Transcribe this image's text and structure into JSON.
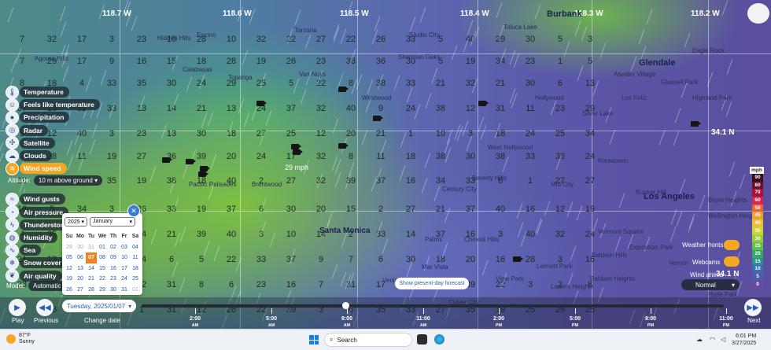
{
  "map": {
    "longitudes": [
      "118.7 W",
      "118.6 W",
      "118.5 W",
      "118.4 W",
      "118.3 W",
      "118.2 W"
    ],
    "latitude_labels": [
      "34.1 N",
      "34.1 N"
    ],
    "wind_readout": "29 mph",
    "cities": [
      "Glendale",
      "Burbank",
      "Los Angeles",
      "Santa Monica"
    ],
    "places": [
      "Calabasas",
      "Tarzana",
      "Sherman Oaks",
      "West Hollywood",
      "Beverly Hills",
      "Century City",
      "Topanga",
      "Hidden Hills",
      "Agoura Hills",
      "Mar Vista",
      "Venice",
      "Baldwin Hills",
      "Leimert Park",
      "Bunker Hill",
      "Wellington Heights",
      "Baldwin Heights",
      "Culver City",
      "Eagle Rock",
      "Glassell Park",
      "Silver Lake",
      "Hyde Park",
      "Ladera Heights",
      "View Park",
      "Cheviot Hills",
      "Palms",
      "Brentwood",
      "Pacific Palisades",
      "Westwood",
      "Encino",
      "Van Nuys",
      "Studio City",
      "Toluca Lake",
      "Mid City",
      "Koreatown",
      "Vermont Square",
      "Exposition Park",
      "Hollywood",
      "Los Feliz",
      "Atwater Village",
      "Highland Park",
      "Boyle Heights",
      "Vernon"
    ],
    "grid_values": [
      [
        7,
        32,
        17,
        3,
        23,
        10,
        28,
        10,
        32,
        22,
        27,
        22,
        26,
        33,
        5,
        40,
        29,
        30,
        5,
        3
      ],
      [
        7,
        29,
        17,
        9,
        16,
        15,
        18,
        28,
        19,
        26,
        23,
        38,
        36,
        30,
        5,
        19,
        34,
        23,
        1,
        5
      ],
      [
        8,
        18,
        4,
        33,
        35,
        30,
        24,
        29,
        25,
        5,
        22,
        8,
        38,
        33,
        21,
        32,
        21,
        30,
        6,
        13
      ],
      [
        37,
        13,
        31,
        33,
        13,
        14,
        21,
        13,
        24,
        37,
        32,
        40,
        9,
        24,
        38,
        12,
        31,
        11,
        23,
        29
      ],
      [
        5,
        12,
        40,
        3,
        23,
        13,
        30,
        18,
        27,
        25,
        12,
        20,
        21,
        1,
        10,
        3,
        18,
        24,
        25,
        34
      ],
      [
        3,
        28,
        11,
        19,
        27,
        36,
        39,
        20,
        24,
        17,
        32,
        8,
        11,
        18,
        38,
        30,
        38,
        33,
        38,
        24
      ],
      [
        16,
        39,
        25,
        35,
        19,
        38,
        18,
        40,
        2,
        27,
        32,
        39,
        37,
        16,
        34,
        33,
        6,
        1,
        27,
        27
      ],
      [
        16,
        5,
        34,
        3,
        26,
        33,
        19,
        37,
        6,
        30,
        20,
        15,
        2,
        27,
        21,
        37,
        40,
        16,
        12,
        19
      ],
      [
        4,
        35,
        12,
        21,
        14,
        21,
        39,
        40,
        3,
        10,
        14,
        2,
        33,
        14,
        37,
        16,
        3,
        40,
        32,
        24
      ],
      [
        21,
        13,
        16,
        18,
        14,
        6,
        5,
        22,
        33,
        37,
        9,
        7,
        6,
        30,
        18,
        20,
        16,
        28,
        3,
        16
      ],
      [
        28,
        12,
        12,
        32,
        32,
        31,
        8,
        6,
        23,
        16,
        7,
        31,
        17,
        22,
        27,
        39,
        22,
        3,
        2,
        8
      ],
      [
        38,
        38,
        39,
        17,
        1,
        31,
        12,
        28,
        22,
        39,
        3,
        6,
        35,
        33,
        27,
        35,
        19,
        25,
        29,
        25
      ]
    ]
  },
  "layers": [
    {
      "label": "Temperature",
      "icon": "thermometer-icon",
      "active": false
    },
    {
      "label": "Feels like temperature",
      "icon": "person-temperature-icon",
      "active": false
    },
    {
      "label": "Precipitation",
      "icon": "droplet-icon",
      "active": false
    },
    {
      "label": "Radar",
      "icon": "radar-icon",
      "active": false
    },
    {
      "label": "Satellite",
      "icon": "satellite-icon",
      "active": false
    },
    {
      "label": "Clouds",
      "icon": "cloud-icon",
      "active": false
    },
    {
      "label": "Wind speed",
      "icon": "wind-icon",
      "active": true
    },
    {
      "label": "Wind gusts",
      "icon": "wind-gust-icon",
      "active": false
    },
    {
      "label": "Air pressure",
      "icon": "gauge-icon",
      "active": false
    },
    {
      "label": "Thunderstorms",
      "icon": "lightning-icon",
      "active": false
    },
    {
      "label": "Humidity",
      "icon": "humidity-icon",
      "active": false
    },
    {
      "label": "Sea",
      "icon": "wave-icon",
      "active": false
    },
    {
      "label": "Snow cover",
      "icon": "snowflake-icon",
      "active": false
    },
    {
      "label": "Air quality",
      "icon": "leaf-icon",
      "active": false
    }
  ],
  "altitude": {
    "label": "Altitude:",
    "value": "10 m above ground"
  },
  "model": {
    "label": "Model:",
    "value": "Automatic ("
  },
  "calendar": {
    "year": "2025",
    "month": "January",
    "weekdays": [
      "Su",
      "Mo",
      "Tu",
      "We",
      "Th",
      "Fr",
      "Sa"
    ],
    "weeks": [
      [
        {
          "d": "29",
          "dim": true
        },
        {
          "d": "30",
          "dim": true
        },
        {
          "d": "31",
          "dim": true
        },
        {
          "d": "01"
        },
        {
          "d": "02"
        },
        {
          "d": "03"
        },
        {
          "d": "04"
        }
      ],
      [
        {
          "d": "05"
        },
        {
          "d": "06"
        },
        {
          "d": "07",
          "sel": true
        },
        {
          "d": "08"
        },
        {
          "d": "09"
        },
        {
          "d": "10"
        },
        {
          "d": "11"
        }
      ],
      [
        {
          "d": "12"
        },
        {
          "d": "13"
        },
        {
          "d": "14"
        },
        {
          "d": "15"
        },
        {
          "d": "16"
        },
        {
          "d": "17"
        },
        {
          "d": "18"
        }
      ],
      [
        {
          "d": "19"
        },
        {
          "d": "20"
        },
        {
          "d": "21"
        },
        {
          "d": "22"
        },
        {
          "d": "23"
        },
        {
          "d": "24"
        },
        {
          "d": "25"
        }
      ],
      [
        {
          "d": "26"
        },
        {
          "d": "27"
        },
        {
          "d": "28"
        },
        {
          "d": "29"
        },
        {
          "d": "30"
        },
        {
          "d": "31"
        },
        {
          "d": "01",
          "dim": true
        }
      ]
    ]
  },
  "timeline": {
    "play_label": "Play",
    "previous_label": "Previous",
    "change_date_label": "Change date",
    "next_label": "Next",
    "date_value": "Tuesday, 2025/01/07",
    "present_forecast_label": "Show present-day forecast",
    "ticks": [
      {
        "t": "2:00",
        "ap": "AM"
      },
      {
        "t": "5:00",
        "ap": "AM"
      },
      {
        "t": "8:00",
        "ap": "AM"
      },
      {
        "t": "11:00",
        "ap": "AM"
      },
      {
        "t": "2:00",
        "ap": "PM"
      },
      {
        "t": "5:00",
        "ap": "PM"
      },
      {
        "t": "8:00",
        "ap": "PM"
      },
      {
        "t": "11:00",
        "ap": "PM"
      }
    ],
    "position_fraction": 0.35
  },
  "legend": {
    "unit": "mph",
    "values": [
      "90",
      "80",
      "70",
      "60",
      "50",
      "45",
      "40",
      "35",
      "30",
      "25",
      "20",
      "15",
      "10",
      "5",
      "0"
    ],
    "colors": [
      "#3b0a1e",
      "#6e0f2a",
      "#a3123a",
      "#d4274a",
      "#e8673a",
      "#eea036",
      "#e6c230",
      "#c9d630",
      "#95cc3a",
      "#5fbf4a",
      "#36a86a",
      "#2e8e96",
      "#3a6cb4",
      "#5058b0",
      "#6a4aa0"
    ]
  },
  "right_controls": {
    "weather_fronts_label": "Weather fronts",
    "webcams_label": "Webcams",
    "wind_animation_label": "Wind anima",
    "wind_animation_value": "Normal"
  },
  "taskbar": {
    "temperature": "87°F",
    "condition": "Sunny",
    "search_placeholder": "Search",
    "time": "6:01 PM",
    "date": "3/27/2025"
  }
}
